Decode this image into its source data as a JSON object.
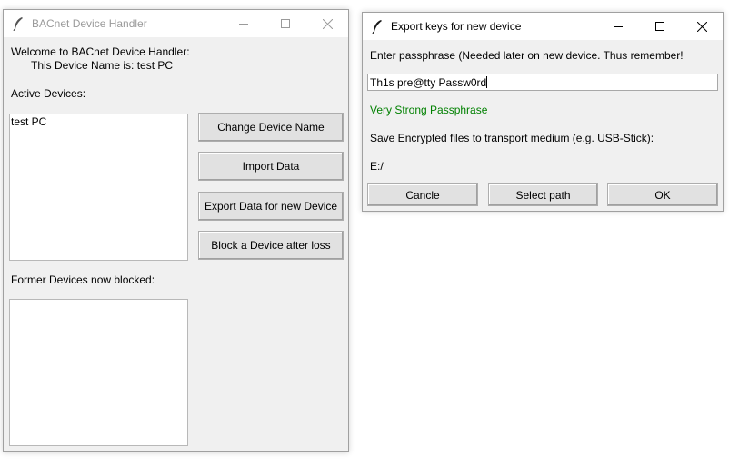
{
  "main_window": {
    "title": "BACnet Device Handler",
    "welcome_text": "Welcome to BACnet Device Handler:",
    "device_name_text": "This Device Name is: test PC",
    "active_devices_label": "Active Devices:",
    "active_devices": [
      "test PC"
    ],
    "former_devices_label": "Former Devices now blocked:",
    "former_devices": [],
    "buttons": {
      "change_name": "Change Device Name",
      "import": "Import Data",
      "export": "Export Data for new Device",
      "block": "Block a Device after loss"
    }
  },
  "export_dialog": {
    "title": "Export keys for new device",
    "prompt": "Enter passphrase (Needed later on new device. Thus remember!",
    "passphrase_value": "Th1s pre@tty Passw0rd",
    "strength_text": "Very Strong Passphrase",
    "strength_color": "#008000",
    "save_prompt": "Save Encrypted files to transport medium (e.g. USB-Stick):",
    "path": "E:/",
    "buttons": {
      "cancel": "Cancle",
      "select_path": "Select path",
      "ok": "OK"
    }
  }
}
